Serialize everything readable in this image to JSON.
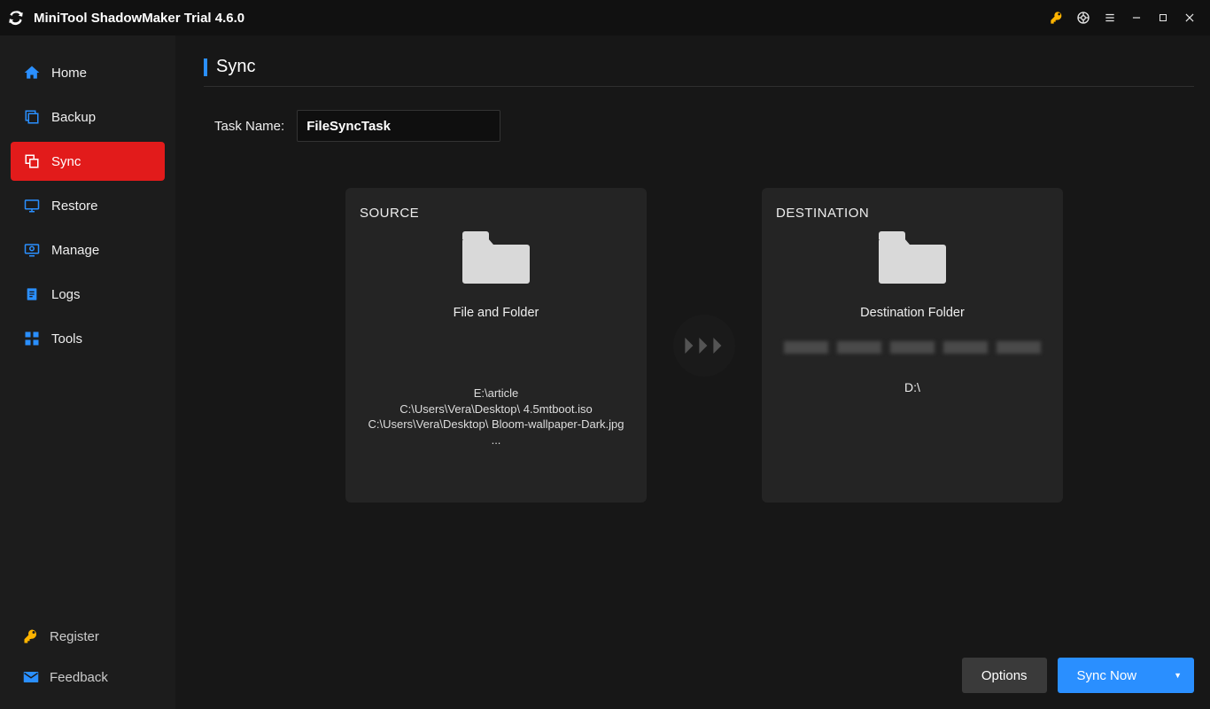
{
  "window": {
    "title": "MiniTool ShadowMaker Trial 4.6.0"
  },
  "sidebar": {
    "items": [
      {
        "label": "Home"
      },
      {
        "label": "Backup"
      },
      {
        "label": "Sync"
      },
      {
        "label": "Restore"
      },
      {
        "label": "Manage"
      },
      {
        "label": "Logs"
      },
      {
        "label": "Tools"
      }
    ],
    "register": "Register",
    "feedback": "Feedback"
  },
  "page": {
    "title": "Sync",
    "task_label": "Task Name:",
    "task_value": "FileSyncTask"
  },
  "source": {
    "heading": "SOURCE",
    "subtitle": "File and Folder",
    "paths": "E:\\article\nC:\\Users\\Vera\\Desktop\\    4.5mtboot.iso\nC:\\Users\\Vera\\Desktop\\   Bloom-wallpaper-Dark.jpg\n..."
  },
  "destination": {
    "heading": "DESTINATION",
    "subtitle": "Destination Folder",
    "drive": "D:\\"
  },
  "footer": {
    "options": "Options",
    "sync_now": "Sync Now"
  }
}
